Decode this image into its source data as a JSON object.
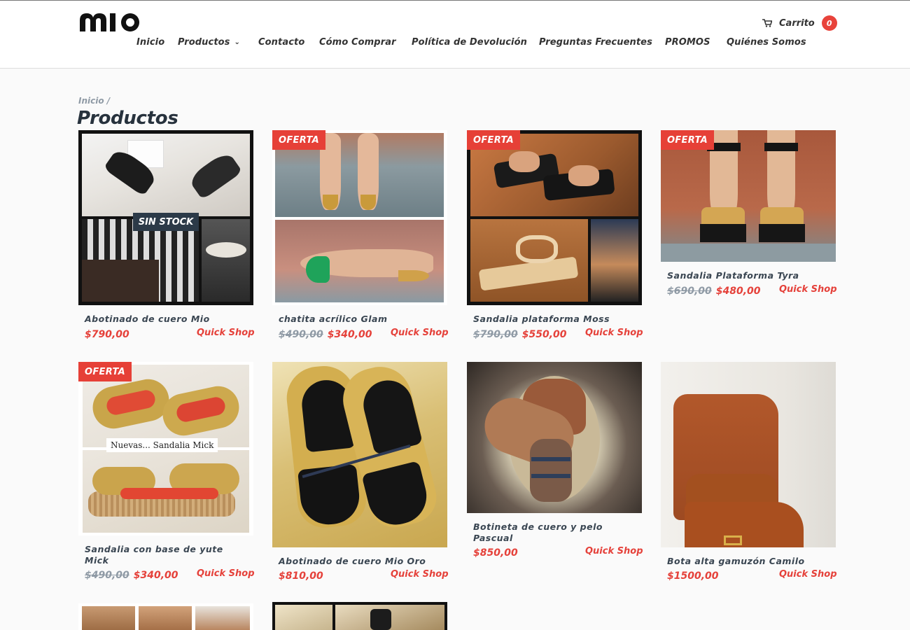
{
  "header": {
    "logo_text": "MIO",
    "nav": [
      {
        "label": "Inicio"
      },
      {
        "label": "Productos",
        "has_dropdown": true
      },
      {
        "label": "Contacto"
      },
      {
        "label": "Cómo Comprar"
      },
      {
        "label": "Política de Devolución"
      },
      {
        "label": "Preguntas Frecuentes"
      },
      {
        "label": "PROMOS"
      },
      {
        "label": "Quiénes Somos"
      }
    ],
    "cart_label": "Carrito",
    "cart_count": "0"
  },
  "breadcrumb": {
    "home": "Inicio",
    "separator": "/"
  },
  "page_title": "Productos",
  "labels": {
    "offer_badge": "OFERTA",
    "no_stock_badge": "SIN STOCK",
    "quick_shop": "Quick Shop",
    "image_caption": "Nuevas... Sandalia Mick"
  },
  "products": [
    {
      "name": "Abotinado de cuero Mio",
      "old_price": "",
      "price": "$790,00",
      "badge": "",
      "no_stock": true
    },
    {
      "name": "chatita acrílico Glam",
      "old_price": "$490,00",
      "price": "$340,00",
      "badge": "OFERTA"
    },
    {
      "name": "Sandalia plataforma Moss",
      "old_price": "$790,00",
      "price": "$550,00",
      "badge": "OFERTA"
    },
    {
      "name": "Sandalia Plataforma Tyra",
      "old_price": "$690,00",
      "price": "$480,00",
      "badge": "OFERTA"
    },
    {
      "name": "Sandalia con base de yute Mick",
      "old_price": "$490,00",
      "price": "$340,00",
      "badge": "OFERTA"
    },
    {
      "name": "Abotinado de cuero Mio Oro",
      "old_price": "",
      "price": "$810,00",
      "badge": ""
    },
    {
      "name": "Botineta de cuero y pelo Pascual",
      "old_price": "",
      "price": "$850,00",
      "badge": ""
    },
    {
      "name": "Bota alta gamuzón Camilo",
      "old_price": "",
      "price": "$1500,00",
      "badge": ""
    }
  ],
  "colors": {
    "accent": "#e5413a",
    "dark": "#27323d",
    "muted": "#8f9aa5"
  }
}
